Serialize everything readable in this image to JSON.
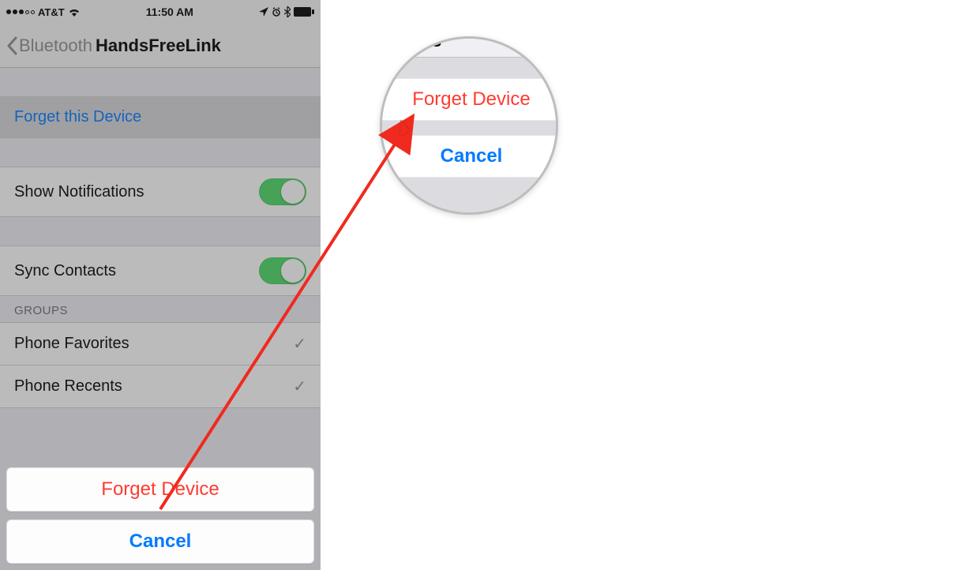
{
  "status_bar": {
    "carrier": "AT&T",
    "time": "11:50 AM"
  },
  "nav": {
    "back_label": "Bluetooth",
    "title": "HandsFreeLink"
  },
  "rows": {
    "forget_this_device": "Forget this Device",
    "show_notifications": "Show Notifications",
    "sync_contacts": "Sync Contacts"
  },
  "groups": {
    "header": "GROUPS",
    "items": [
      "Phone Favorites",
      "Phone Recents"
    ]
  },
  "action_sheet": {
    "forget": "Forget Device",
    "cancel": "Cancel"
  },
  "callout": {
    "top_fragment": "ts",
    "forget": "Forget Device",
    "cancel": "Cancel"
  },
  "colors": {
    "ios_blue": "#007aff",
    "ios_red": "#ff3b30",
    "ios_green": "#4cd964"
  }
}
